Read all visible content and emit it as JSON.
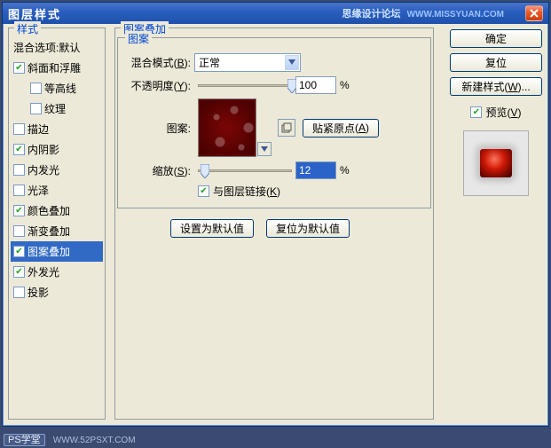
{
  "window": {
    "title": "图层样式",
    "watermark": "思缘设计论坛",
    "watermark_url": "WWW.MISSYUAN.COM"
  },
  "sidebar": {
    "legend": "样式",
    "items": [
      {
        "label": "混合选项:默认",
        "checked": null,
        "indent": 0,
        "parent": true,
        "selected": false
      },
      {
        "label": "斜面和浮雕",
        "checked": true,
        "indent": 0,
        "selected": false
      },
      {
        "label": "等高线",
        "checked": false,
        "indent": 1,
        "selected": false
      },
      {
        "label": "纹理",
        "checked": false,
        "indent": 1,
        "selected": false
      },
      {
        "label": "描边",
        "checked": false,
        "indent": 0,
        "selected": false
      },
      {
        "label": "内阴影",
        "checked": true,
        "indent": 0,
        "selected": false
      },
      {
        "label": "内发光",
        "checked": false,
        "indent": 0,
        "selected": false
      },
      {
        "label": "光泽",
        "checked": false,
        "indent": 0,
        "selected": false
      },
      {
        "label": "颜色叠加",
        "checked": true,
        "indent": 0,
        "selected": false
      },
      {
        "label": "渐变叠加",
        "checked": false,
        "indent": 0,
        "selected": false
      },
      {
        "label": "图案叠加",
        "checked": true,
        "indent": 0,
        "selected": true
      },
      {
        "label": "外发光",
        "checked": true,
        "indent": 0,
        "selected": false
      },
      {
        "label": "投影",
        "checked": false,
        "indent": 0,
        "selected": false
      }
    ]
  },
  "main": {
    "legend": "图案叠加",
    "inner_legend": "图案",
    "blend_mode_label": "混合模式",
    "blend_mode_key": "B",
    "blend_mode_value": "正常",
    "opacity_label": "不透明度",
    "opacity_key": "Y",
    "opacity_value": "100",
    "opacity_unit": "%",
    "pattern_label": "图案:",
    "snap_label": "贴紧原点",
    "snap_key": "A",
    "scale_label": "缩放",
    "scale_key": "S",
    "scale_value": "12",
    "scale_unit": "%",
    "link_label": "与图层链接",
    "link_key": "K",
    "link_checked": true,
    "set_default": "设置为默认值",
    "reset_default": "复位为默认值",
    "opacity_slider_pct": 100,
    "scale_slider_pct": 8
  },
  "right": {
    "ok": "确定",
    "reset": "复位",
    "new_style": "新建样式",
    "new_style_key": "W",
    "preview_label": "预览",
    "preview_key": "V",
    "preview_checked": true
  },
  "footer": {
    "tag": "PS学堂",
    "url": "WWW.52PSXT.COM"
  }
}
